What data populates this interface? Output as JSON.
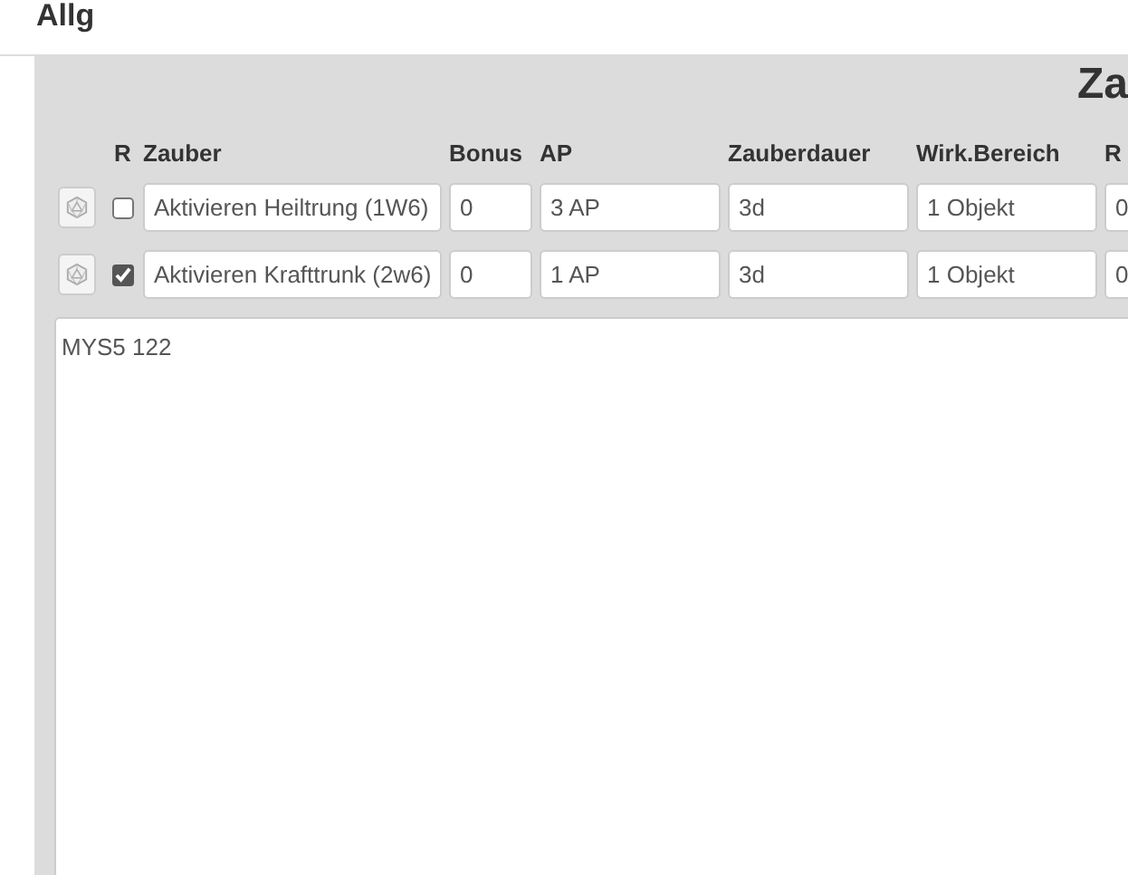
{
  "heading": "Allg",
  "section_title": "Za",
  "columns": [
    "R",
    "Zauber",
    "Bonus",
    "AP",
    "Zauberdauer",
    "Wirk.Bereich",
    "R"
  ],
  "rows": [
    {
      "checked": false,
      "cells": [
        "Aktivieren Heiltrung (1W6)",
        "0",
        "3 AP",
        "3d",
        "1 Objekt",
        "0"
      ]
    },
    {
      "checked": true,
      "cells": [
        "Aktivieren Krafttrunk (2w6)",
        "0",
        "1 AP",
        "3d",
        "1 Objekt",
        "0"
      ]
    }
  ],
  "notes": "MYS5 122"
}
